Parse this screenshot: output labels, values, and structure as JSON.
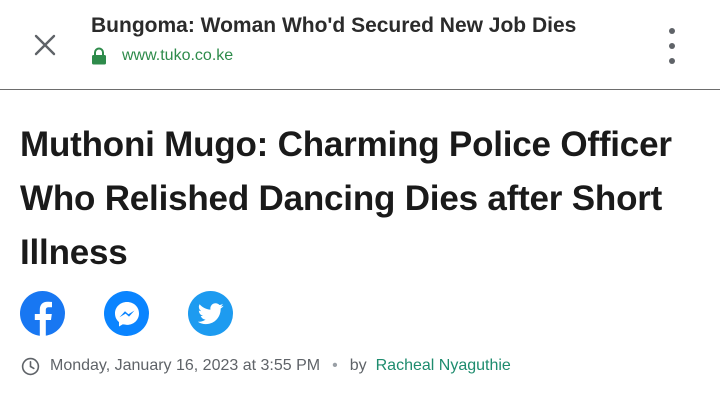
{
  "browser": {
    "page_title": "Bungoma: Woman Who'd Secured New Job Dies",
    "url": "www.tuko.co.ke",
    "close_icon": "close-icon",
    "lock_icon": "lock-icon",
    "menu_icon": "more-vertical-icon"
  },
  "article": {
    "headline": "Muthoni Mugo: Charming Police Officer Who Relished Dancing Dies after Short Illness",
    "share": [
      {
        "network": "Facebook",
        "icon": "facebook-icon",
        "color": "#1877f2"
      },
      {
        "network": "Messenger",
        "icon": "messenger-icon",
        "color": "#0a84ff"
      },
      {
        "network": "Twitter",
        "icon": "twitter-icon",
        "color": "#1d9bf0"
      }
    ],
    "date": "Monday, January 16, 2023 at 3:55 PM",
    "separator": "•",
    "by_label": "by",
    "author": "Racheal Nyaguthie"
  },
  "colors": {
    "url_green": "#2e8b4b",
    "author_green": "#1e8c6e",
    "headline": "#1a1a1a"
  }
}
